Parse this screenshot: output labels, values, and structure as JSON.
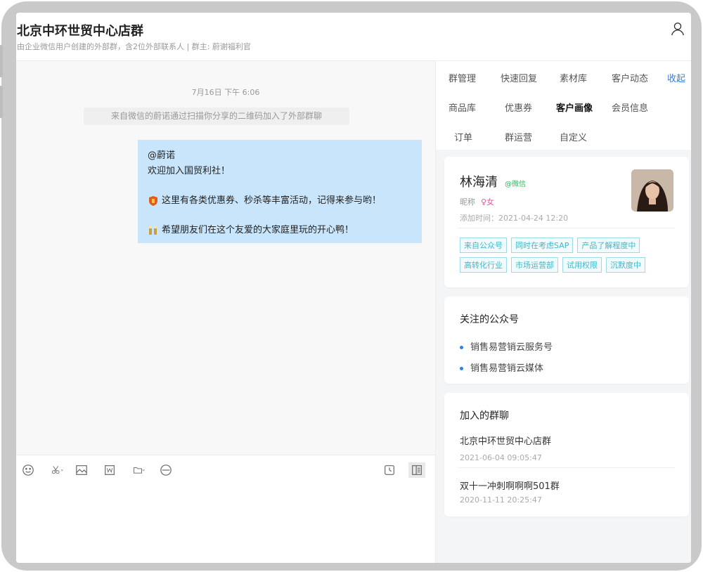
{
  "header": {
    "title": "北京中环世贸中心店群",
    "subtitle": "由企业微信用户创建的外部群，含2位外部联系人 | 群主: 蔚谢福利官"
  },
  "chat": {
    "time": "7月16日 下午 6:06",
    "system_message": "来自微信的蔚诺通过扫描你分享的二维码加入了外部群聊",
    "bubble": {
      "line1": "@蔚诺",
      "line2": "欢迎加入国贸利社！",
      "line3": "这里有各类优惠券、秒杀等丰富活动，记得来参与哟！",
      "line4": "希望朋友们在这个友爱的大家庭里玩的开心鸭！"
    }
  },
  "toolbar": {
    "icons": [
      "emoji-icon",
      "scissors-icon",
      "image-icon",
      "word-icon",
      "folder-icon",
      "minus-circle-icon",
      "clock-icon",
      "sidebar-toggle-icon"
    ]
  },
  "tabs": {
    "row1": [
      "群管理",
      "快速回复",
      "素材库",
      "客户动态",
      "收起"
    ],
    "row2": [
      "商品库",
      "优惠券",
      "客户画像",
      "会员信息"
    ],
    "row3": [
      "订单",
      "群运营",
      "自定义"
    ],
    "active": "客户画像"
  },
  "profile": {
    "name": "林海清",
    "source": "@微信",
    "nickname": "昵称",
    "gender": "♀女",
    "added_label": "添加时间：",
    "added_time": "2021-04-24 12:20",
    "tags_row1": [
      "来自公众号",
      "同时在考虑SAP",
      "产品了解程度中"
    ],
    "tags_row2": [
      "高转化行业",
      "市场运营部",
      "试用权限",
      "沉默度中"
    ]
  },
  "official_accounts": {
    "title": "关注的公众号",
    "items": [
      "销售易营销云服务号",
      "销售易营销云媒体"
    ]
  },
  "joined_groups": {
    "title": "加入的群聊",
    "items": [
      {
        "name": "北京中环世贸中心店群",
        "time": "2021-06-04 09:05:47"
      },
      {
        "name": "双十一冲刺啊啊啊501群",
        "time": "2020-11-11 20:25:47"
      }
    ]
  },
  "colors": {
    "accent": "#2f7fe8",
    "bubble": "#c9e5fb",
    "tag_text": "#44b6c7",
    "wechat_green": "#2fb85e"
  }
}
